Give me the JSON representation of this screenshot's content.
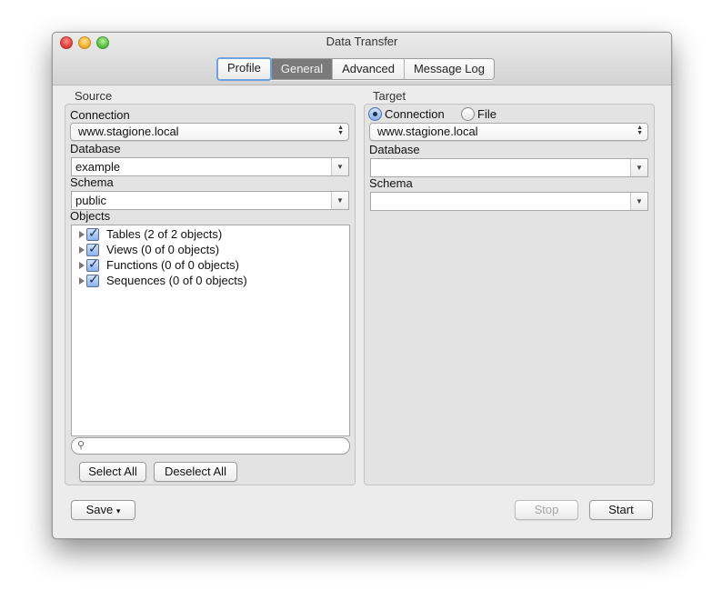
{
  "window": {
    "title": "Data Transfer"
  },
  "tabs": [
    {
      "label": "Profile",
      "state": "focused"
    },
    {
      "label": "General",
      "state": "selected"
    },
    {
      "label": "Advanced",
      "state": "normal"
    },
    {
      "label": "Message Log",
      "state": "normal"
    }
  ],
  "source": {
    "section_label": "Source",
    "connection_label": "Connection",
    "connection_value": "www.stagione.local",
    "database_label": "Database",
    "database_value": "example",
    "schema_label": "Schema",
    "schema_value": "public",
    "objects_label": "Objects",
    "objects": [
      {
        "label": "Tables (2 of 2 objects)",
        "checked": true
      },
      {
        "label": "Views (0 of 0 objects)",
        "checked": true
      },
      {
        "label": "Functions (0 of 0 objects)",
        "checked": true
      },
      {
        "label": "Sequences (0 of 0 objects)",
        "checked": true
      }
    ],
    "search_value": "",
    "select_all_label": "Select All",
    "deselect_all_label": "Deselect All"
  },
  "target": {
    "section_label": "Target",
    "radio_connection_label": "Connection",
    "radio_file_label": "File",
    "selected_mode": "Connection",
    "connection_value": "www.stagione.local",
    "database_label": "Database",
    "database_value": "",
    "schema_label": "Schema",
    "schema_value": ""
  },
  "footer": {
    "save_label": "Save",
    "stop_label": "Stop",
    "start_label": "Start"
  },
  "icons": {
    "checkmark": "✓",
    "dropdown": "▼",
    "updown_up": "▲",
    "updown_down": "▼",
    "save_menu": "▾",
    "search": "🔍"
  }
}
